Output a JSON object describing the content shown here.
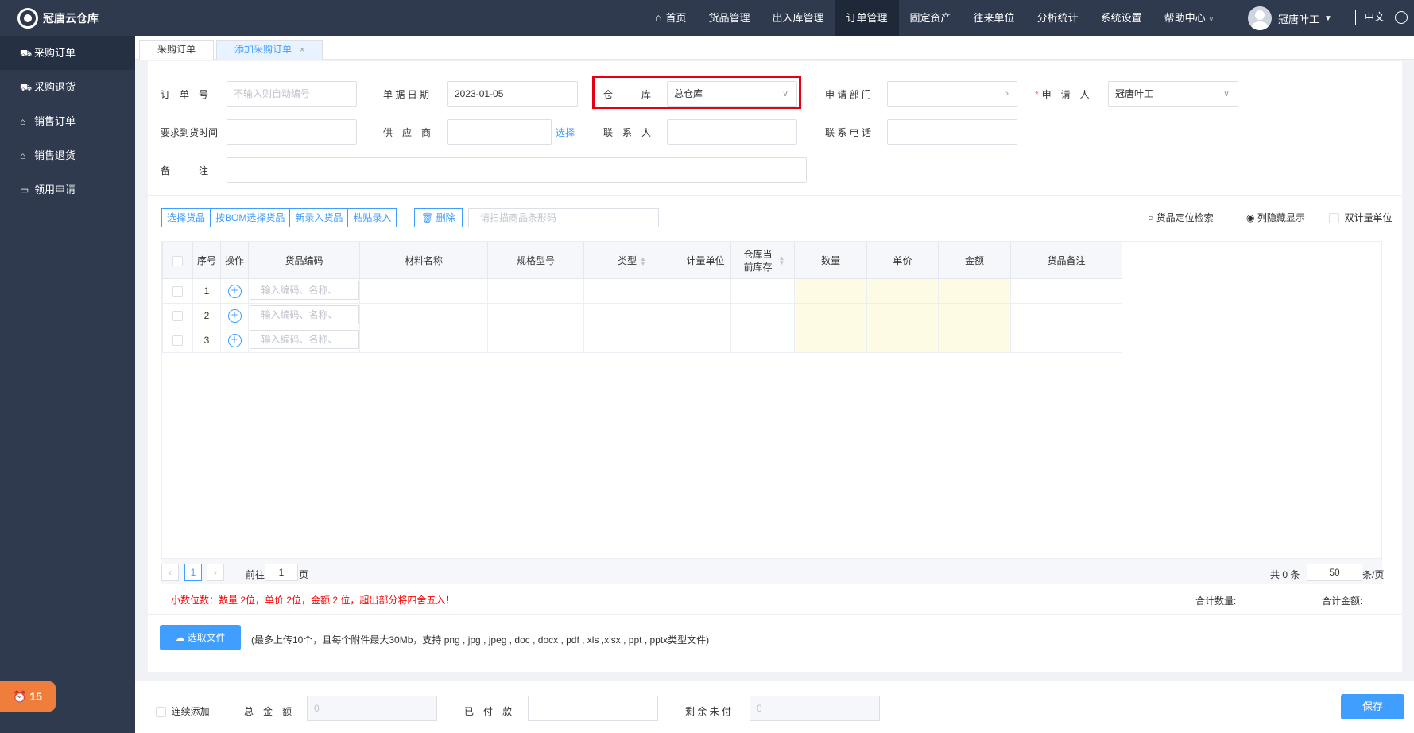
{
  "app": {
    "title": "冠唐云仓库"
  },
  "nav": {
    "items": [
      "首页",
      "货品管理",
      "出入库管理",
      "订单管理",
      "固定资产",
      "往来单位",
      "分析统计",
      "系统设置",
      "帮助中心"
    ],
    "active": "订单管理"
  },
  "user": {
    "name": "冠唐叶工",
    "language": "中文"
  },
  "sidebar": {
    "items": [
      {
        "label": "采购订单",
        "icon": "cart-icon"
      },
      {
        "label": "采购退货",
        "icon": "cart-icon"
      },
      {
        "label": "销售订单",
        "icon": "bag-icon"
      },
      {
        "label": "销售退货",
        "icon": "bag-icon"
      },
      {
        "label": "领用申请",
        "icon": "folder-icon"
      }
    ],
    "badge_count": "15"
  },
  "tabs": [
    {
      "label": "采购订单"
    },
    {
      "label": "添加采购订单"
    }
  ],
  "form": {
    "order_no_label": "订　单　号",
    "order_no_placeholder": "不输入则自动编号",
    "date_label": "单 据 日 期",
    "date_value": "2023-01-05",
    "warehouse_label": "仓　　　库",
    "warehouse_value": "总仓库",
    "dept_label": "申 请 部 门",
    "dept_value": "",
    "applicant_label": "申　请　人",
    "applicant_value": "冠唐叶工",
    "arrival_label": "要求到货时间",
    "supplier_label": "供　应　商",
    "supplier_link": "选择",
    "contact_label": "联　系　人",
    "phone_label": "联 系 电 话",
    "remark_label": "备　　　注"
  },
  "toolbar": {
    "buttons": [
      "选择货品",
      "按BOM选择货品",
      "新录入货品",
      "粘贴录入"
    ],
    "delete_label": "删除",
    "scan_placeholder": "请扫描商品条形码",
    "locate_label": "货品定位检索",
    "hidden_cols_label": "列隐藏显示",
    "dual_unit_label": "双计量单位"
  },
  "table": {
    "headers": [
      "序号",
      "操作",
      "货品编码",
      "材料名称",
      "规格型号",
      "类型",
      "计量单位",
      "仓库当前库存",
      "数量",
      "单价",
      "金额",
      "货品备注"
    ],
    "rows": [
      {
        "index": "1"
      },
      {
        "index": "2"
      },
      {
        "index": "3"
      }
    ],
    "code_placeholder": "输入编码、名称、"
  },
  "pager": {
    "current_page": "1",
    "goto_prefix": "前往",
    "goto_value": "1",
    "goto_suffix": "页",
    "total": "共 0 条",
    "page_size": "50",
    "page_size_suffix": "条/页"
  },
  "notes": {
    "decimal_note": "小数位数：数量 2位，单价 2位，金额 2 位，超出部分将四舍五入！",
    "total_qty_label": "合计数量:",
    "total_amount_label": "合计金额:"
  },
  "upload": {
    "button_label": "选取文件",
    "note": "(最多上传10个，且每个附件最大30Mb，支持 png , jpg , jpeg , doc , docx , pdf , xls ,xlsx , ppt , pptx类型文件)"
  },
  "bottom": {
    "continuous_label": "连续添加",
    "total_label": "总　金　额",
    "total_value": "0",
    "paid_label": "已　付　款",
    "paid_value": "",
    "remaining_label": "剩 余 未 付",
    "remaining_value": "0",
    "save_label": "保存"
  }
}
